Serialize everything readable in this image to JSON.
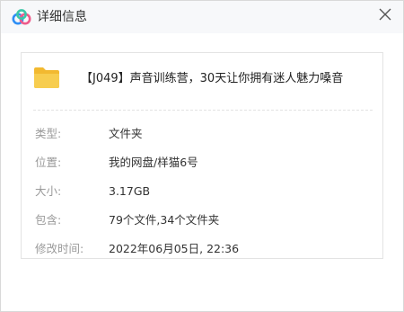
{
  "window": {
    "title": "详细信息",
    "close_glyph": "✕",
    "logo_icon": "baidu-netdisk-cloud-icon"
  },
  "file": {
    "icon": "folder-icon",
    "name": "【J049】声音训练营，30天让你拥有迷人魅力嗓音"
  },
  "details": {
    "type_label": "类型:",
    "type_value": "文件夹",
    "location_label": "位置:",
    "location_value": "我的网盘/样猫6号",
    "size_label": "大小:",
    "size_value": "3.17GB",
    "contains_label": "包含:",
    "contains_value": "79个文件,34个文件夹",
    "modified_label": "修改时间:",
    "modified_value": "2022年06月05日, 22:36"
  },
  "colors": {
    "titlebar_bg": "#f7f8fa",
    "folder_yellow": "#f5c744",
    "logo_blue": "#2f8ef5",
    "logo_pink": "#ef5a8a",
    "logo_green": "#3cc7a8"
  }
}
